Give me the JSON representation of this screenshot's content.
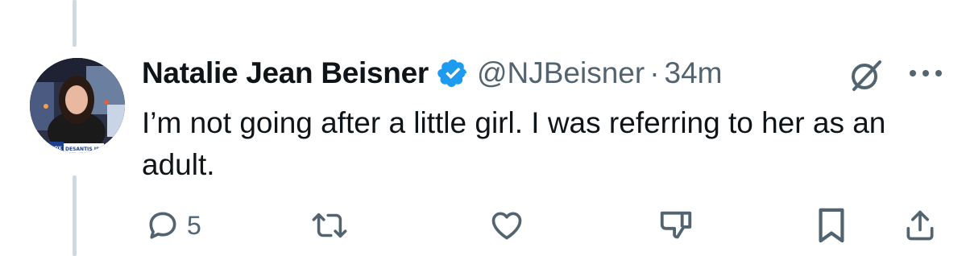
{
  "author": {
    "name": "Natalie Jean Beisner",
    "handle": "@NJBeisner",
    "separator": "·",
    "time": "34m",
    "verified_icon": "verified-badge-icon",
    "avatar_overlay_text": "DESANTIS IS"
  },
  "tweet": {
    "text": "I’m not going after a little girl. I was referring to her as an adult."
  },
  "actions": {
    "reply_count": "5",
    "icons": [
      "reply-icon",
      "retweet-icon",
      "like-icon",
      "downvote-icon",
      "bookmark-icon",
      "share-icon"
    ]
  },
  "colors": {
    "text": "#0f1419",
    "secondary": "#536471",
    "verified": "#1d9bf0",
    "thread_line": "#cfd9de"
  }
}
